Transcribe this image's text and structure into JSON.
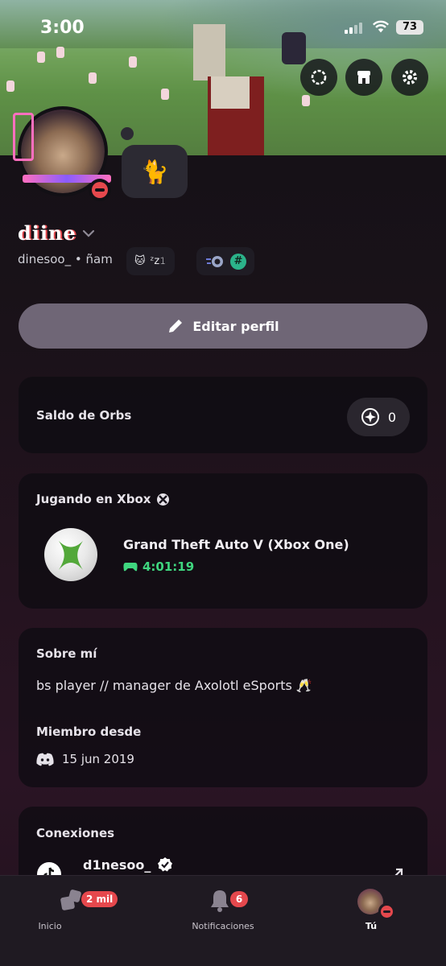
{
  "status_bar": {
    "time": "3:00",
    "battery": "73"
  },
  "profile": {
    "display_name": "diine",
    "username": "dinesoo_",
    "pronouns": "ñam",
    "status_chip_text": "ᶻz𝟷"
  },
  "edit_profile": {
    "label": "Editar perfil"
  },
  "orbs": {
    "title": "Saldo de Orbs",
    "value": "0"
  },
  "activity": {
    "title": "Jugando en Xbox",
    "game": "Grand Theft Auto V (Xbox One)",
    "elapsed": "4:01:19"
  },
  "about": {
    "title": "Sobre mí",
    "bio": "bs player // manager de Axolotl eSports 🥂",
    "member_since_label": "Miembro desde",
    "member_since_date": "15 jun 2019"
  },
  "connections": {
    "title": "Conexiones",
    "user": "d1nesoo_"
  },
  "tabs": {
    "home": {
      "label": "Inicio",
      "badge": "2 mil"
    },
    "notifications": {
      "label": "Notificaciones",
      "badge": "6"
    },
    "you": {
      "label": "Tú"
    }
  },
  "colors": {
    "accent_green": "#3fd67f",
    "dnd_red": "#e5484d",
    "button_gray": "#6f6676",
    "card_bg": "#0e0c12"
  }
}
